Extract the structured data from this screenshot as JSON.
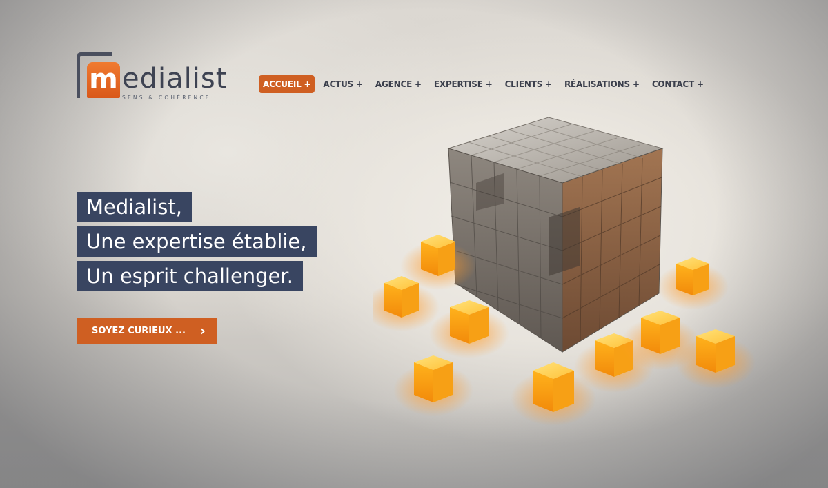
{
  "logo": {
    "wordmark": "edialist",
    "mark_letter": "m",
    "tagline": "SENS & COHÉRENCE",
    "colors": {
      "mark": "#d9581a",
      "text": "#3e4352"
    }
  },
  "nav": {
    "items": [
      {
        "label": "ACCUEIL +",
        "active": true
      },
      {
        "label": "ACTUS +",
        "active": false
      },
      {
        "label": "AGENCE +",
        "active": false
      },
      {
        "label": "EXPERTISE +",
        "active": false
      },
      {
        "label": "CLIENTS +",
        "active": false
      },
      {
        "label": "RÉALISATIONS +",
        "active": false
      },
      {
        "label": "CONTACT +",
        "active": false
      }
    ],
    "accent_color": "#cf5f22"
  },
  "hero": {
    "headline": [
      "Medialist,",
      "Une expertise établie,",
      "Un esprit challenger."
    ],
    "headline_bg": "#394561",
    "cta_label": "SOYEZ CURIEUX ...",
    "cta_icon": "chevron-right-icon",
    "illustration": "metal-cube-with-glowing-orange-cubes"
  }
}
